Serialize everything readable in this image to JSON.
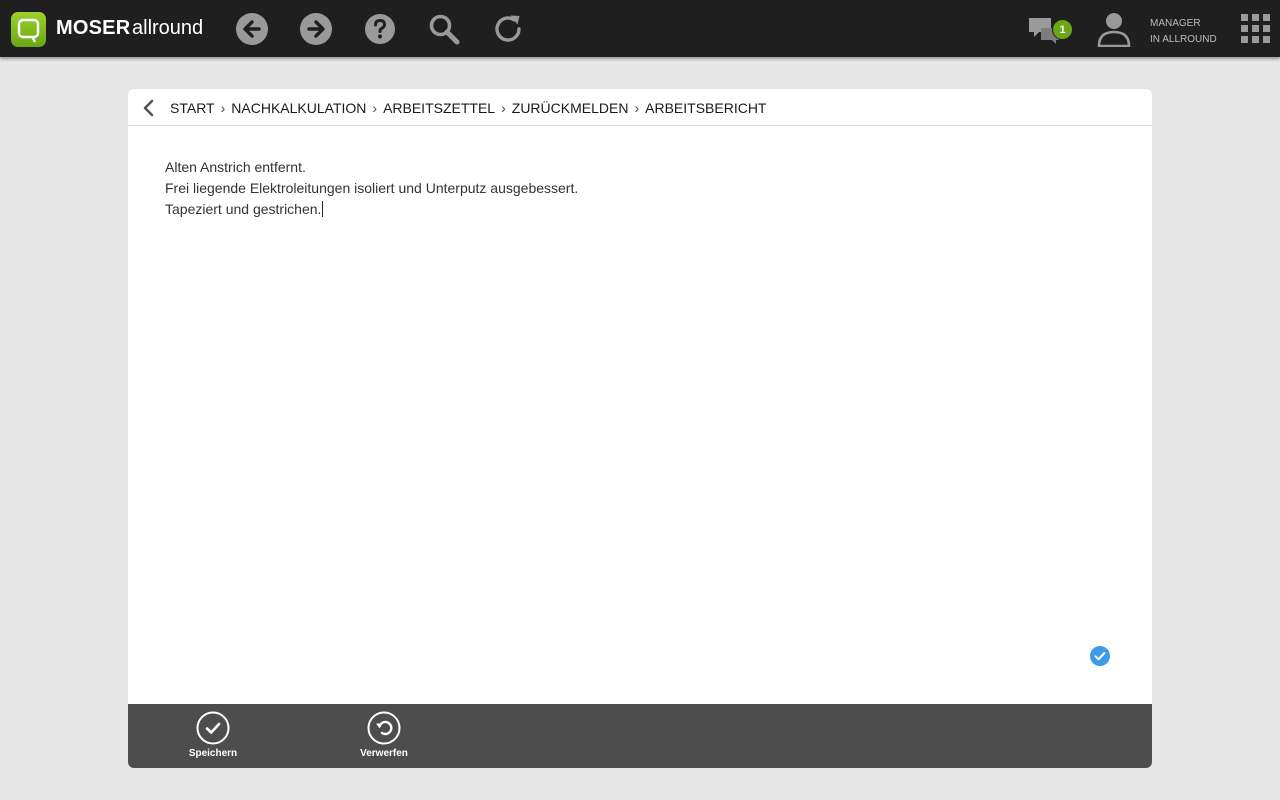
{
  "app": {
    "brand_strong": "MOSER",
    "brand_light": "allround",
    "accent_color": "#78b51d"
  },
  "topbar": {
    "nav_icons": [
      "back-arrow-icon",
      "forward-arrow-icon",
      "help-icon",
      "search-icon",
      "refresh-icon"
    ],
    "messages_badge": "1",
    "user_line1": "MANAGER",
    "user_line2": "IN ALLROUND"
  },
  "breadcrumb": {
    "items": [
      "START",
      "NACHKALKULATION",
      "ARBEITSZETTEL",
      "ZURÜCKMELDEN",
      "ARBEITSBERICHT"
    ],
    "separator": "›"
  },
  "report": {
    "lines": [
      "Alten Anstrich entfernt.",
      "Frei liegende Elektroleitungen isoliert und Unterputz ausgebessert.",
      "Tapeziert und gestrichen."
    ]
  },
  "actions": {
    "save_label": "Speichern",
    "discard_label": "Verwerfen"
  }
}
